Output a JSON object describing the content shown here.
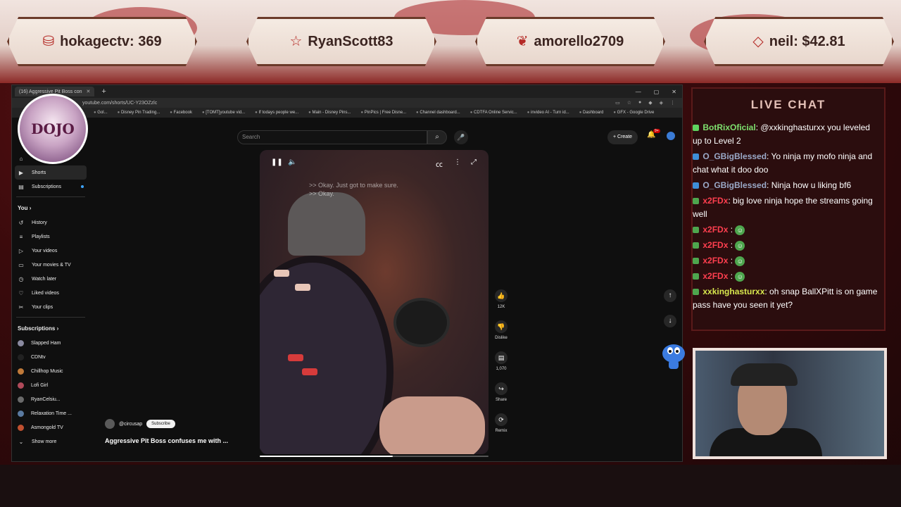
{
  "banners": [
    {
      "icon": "gem-icon",
      "glyph": "⛁",
      "text": "hokagectv: 369"
    },
    {
      "icon": "star-icon",
      "glyph": "☆",
      "text": "RyanScott83"
    },
    {
      "icon": "heart-icon",
      "glyph": "❦",
      "text": "amorello2709"
    },
    {
      "icon": "diamond-icon",
      "glyph": "◇",
      "text": "neil: $42.81"
    }
  ],
  "browser": {
    "tab_title": "(16) Aggressive Pit Boss con",
    "url": "youtube.com/shorts/UC-Y23OZzlc",
    "bookmarks": [
      "Gol...",
      "Disney Pin Trading...",
      "Facebook",
      "[TOMT]youtube vid...",
      "If todays people we...",
      "Main - Disney Pins...",
      "PinPics | Free Disne...",
      "Channel dashboard...",
      "CDTFA Online Servic...",
      "invideo AI - Turn id...",
      "Dashboard",
      "GFX - Google Drive"
    ]
  },
  "youtube": {
    "search_placeholder": "Search",
    "create_label": "+ Create",
    "notif_count": "9+",
    "sidebar_top": [
      {
        "name": "shorts",
        "icon": "▶",
        "label": "Shorts",
        "active": true
      },
      {
        "name": "subscriptions",
        "icon": "▤",
        "label": "Subscriptions",
        "active": false
      }
    ],
    "you_header": "You  ›",
    "you_items": [
      {
        "name": "history",
        "icon": "↺",
        "label": "History"
      },
      {
        "name": "playlists",
        "icon": "≡",
        "label": "Playlists"
      },
      {
        "name": "your-videos",
        "icon": "▷",
        "label": "Your videos"
      },
      {
        "name": "your-movies",
        "icon": "▭",
        "label": "Your movies & TV"
      },
      {
        "name": "watch-later",
        "icon": "◷",
        "label": "Watch later"
      },
      {
        "name": "liked-videos",
        "icon": "♡",
        "label": "Liked videos"
      },
      {
        "name": "your-clips",
        "icon": "✂",
        "label": "Your clips"
      }
    ],
    "subs_header": "Subscriptions  ›",
    "subs": [
      {
        "label": "Slapped Ham",
        "color": "#8a8aa0"
      },
      {
        "label": "CDNtv",
        "color": "#222222"
      },
      {
        "label": "Chillhop Music",
        "color": "#c07a3a"
      },
      {
        "label": "Lofi Girl",
        "color": "#b04a5a"
      },
      {
        "label": "RyanCelsiu...",
        "color": "#6a6a6a"
      },
      {
        "label": "Relaxation Time ...",
        "color": "#5a7aa0"
      },
      {
        "label": "Asmongold TV",
        "color": "#c05030"
      }
    ],
    "show_more": "Show more",
    "video": {
      "caption_line1": ">> Okay. Just got to make sure.",
      "caption_line2": ">> Okay.",
      "channel": "@circusap",
      "subscribe_label": "Subscribe",
      "title": "Aggressive Pit Boss confuses me with ...",
      "progress": 0.58
    },
    "actions": [
      {
        "name": "like",
        "icon": "👍",
        "label": "12K"
      },
      {
        "name": "dislike",
        "icon": "👎",
        "label": "Dislike"
      },
      {
        "name": "comments",
        "icon": "▤",
        "label": "1,070"
      },
      {
        "name": "share",
        "icon": "↪",
        "label": "Share"
      },
      {
        "name": "remix",
        "icon": "⟳",
        "label": "Remix"
      }
    ]
  },
  "dojo_logo_text": "DOJO",
  "chat": {
    "title": "LIVE CHAT",
    "messages": [
      {
        "user": "BotRixOficial",
        "user_color": "#7ee06e",
        "badge_color": "#5fd35f",
        "text": ": @xxkinghasturxx you leveled up to Level 2"
      },
      {
        "user": "O_GBigBlessed",
        "user_color": "#9aa9c8",
        "badge_color": "#3e8ed8",
        "text": ": Yo ninja my mofo ninja and chat what it doo doo"
      },
      {
        "user": "O_GBigBlessed",
        "user_color": "#9aa9c8",
        "badge_color": "#3e8ed8",
        "text": ": Ninja how u liking bf6"
      },
      {
        "user": "x2FDx",
        "user_color": "#ff3f4f",
        "badge_color": "#4ea64e",
        "text": ": big love ninja hope the streams going well"
      },
      {
        "user": "x2FDx",
        "user_color": "#ff3f4f",
        "badge_color": "#4ea64e",
        "text": " : ",
        "emote": "☺"
      },
      {
        "user": "x2FDx",
        "user_color": "#ff3f4f",
        "badge_color": "#4ea64e",
        "text": " : ",
        "emote": "☺"
      },
      {
        "user": "x2FDx",
        "user_color": "#ff3f4f",
        "badge_color": "#4ea64e",
        "text": " : ",
        "emote": "☺"
      },
      {
        "user": "x2FDx",
        "user_color": "#ff3f4f",
        "badge_color": "#4ea64e",
        "text": " : ",
        "emote": "☺"
      },
      {
        "user": "xxkinghasturxx",
        "user_color": "#d8e84e",
        "badge_color": "#4ea64e",
        "text": ": oh snap BallXPitt is on game pass have you seen it yet?"
      }
    ]
  }
}
